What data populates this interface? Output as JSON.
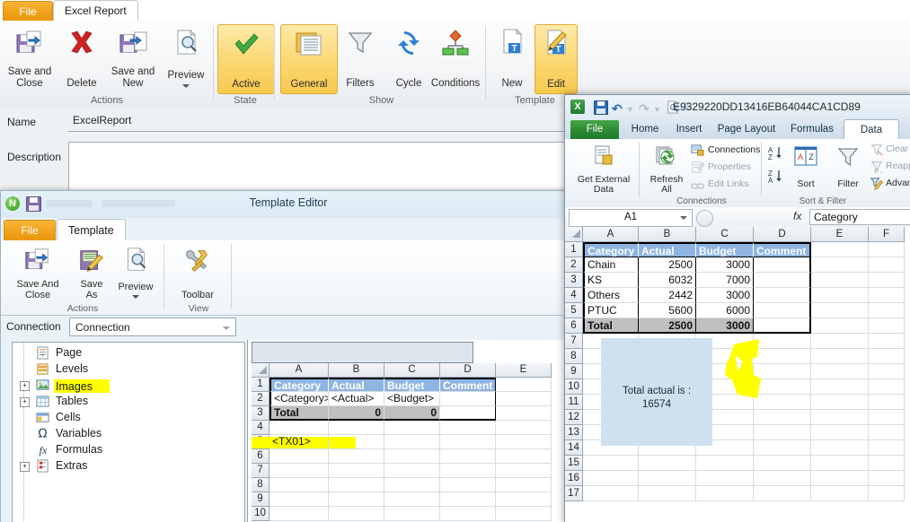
{
  "report_window": {
    "tabs": {
      "file": "File",
      "active": "Excel Report"
    },
    "ribbon_groups": [
      {
        "label": "Actions"
      },
      {
        "label": "State"
      },
      {
        "label": "Show"
      },
      {
        "label": "Template"
      }
    ],
    "buttons": {
      "save_and_close": "Save and\nClose",
      "save_and_close_l1": "Save and",
      "save_and_close_l2": "Close",
      "delete": "Delete",
      "save_and_new_l1": "Save and",
      "save_and_new_l2": "New",
      "preview": "Preview",
      "active": "Active",
      "general": "General",
      "filters": "Filters",
      "cycle": "Cycle",
      "conditions": "Conditions",
      "new": "New",
      "edit": "Edit"
    },
    "form": {
      "name_label": "Name",
      "name_value": "ExcelReport",
      "description_label": "Description",
      "description_value": ""
    }
  },
  "template_editor": {
    "title": "Template Editor",
    "tabs": {
      "file": "File",
      "active": "Template"
    },
    "ribbon_groups": [
      {
        "label": "Actions"
      },
      {
        "label": "View"
      }
    ],
    "buttons": {
      "save_and_close_l1": "Save And",
      "save_and_close_l2": "Close",
      "save_as_l1": "Save",
      "save_as_l2": "As",
      "preview": "Preview",
      "toolbar": "Toolbar"
    },
    "connection": {
      "label": "Connection",
      "value": "Connection"
    },
    "tree": [
      {
        "label": "Page",
        "icon": "page-icon",
        "expandable": false
      },
      {
        "label": "Levels",
        "icon": "levels-icon",
        "expandable": false
      },
      {
        "label": "Images",
        "icon": "images-icon",
        "expandable": true,
        "highlighted": true
      },
      {
        "label": "Tables",
        "icon": "tables-icon",
        "expandable": true
      },
      {
        "label": "Cells",
        "icon": "cells-icon",
        "expandable": false
      },
      {
        "label": "Variables",
        "icon": "omega-icon",
        "expandable": false
      },
      {
        "label": "Formulas",
        "icon": "fx-icon",
        "expandable": false
      },
      {
        "label": "Extras",
        "icon": "extras-icon",
        "expandable": true
      }
    ],
    "sheet": {
      "columns": [
        "A",
        "B",
        "C",
        "D",
        "E"
      ],
      "rows": [
        "1",
        "2",
        "3",
        "4",
        "5",
        "6",
        "7",
        "8",
        "9",
        "10"
      ],
      "data": [
        [
          "Category",
          "Actual",
          "Budget",
          "Comment",
          ""
        ],
        [
          "<Category>",
          "<Actual>",
          "<Budget>",
          "",
          ""
        ],
        [
          "Total",
          "0",
          "0",
          "",
          ""
        ],
        [
          "",
          "",
          "",
          "",
          ""
        ],
        [
          "<TX01>",
          "",
          "",
          "",
          ""
        ],
        [
          "",
          "",
          "",
          "",
          ""
        ],
        [
          "",
          "",
          "",
          "",
          ""
        ],
        [
          "",
          "",
          "",
          "",
          ""
        ],
        [
          "",
          "",
          "",
          "",
          ""
        ],
        [
          "",
          "",
          "",
          "",
          ""
        ]
      ],
      "highlighted_row": "5"
    }
  },
  "excel_window": {
    "title": "E9329220DD13416EB64044CA1CD89",
    "tabs": [
      {
        "label": "File"
      },
      {
        "label": "Home"
      },
      {
        "label": "Insert"
      },
      {
        "label": "Page Layout"
      },
      {
        "label": "Formulas"
      },
      {
        "label": "Data"
      }
    ],
    "ribbon_groups": [
      {
        "label": "Connections"
      },
      {
        "label": "Sort & Filter"
      }
    ],
    "buttons": {
      "get_external_data_l1": "Get External",
      "get_external_data_l2": "Data",
      "refresh_all_l1": "Refresh",
      "refresh_all_l2": "All",
      "connections": "Connections",
      "properties": "Properties",
      "edit_links": "Edit Links",
      "sort_az": "A↓",
      "sort_za": "Z↓",
      "sort": "Sort",
      "filter": "Filter",
      "clear": "Clear",
      "reapply": "Reapply",
      "advanced": "Advanced"
    },
    "formula_bar": {
      "name_box": "A1",
      "fx_label": "fx",
      "formula_value": "Category"
    },
    "sheet": {
      "columns": [
        "A",
        "B",
        "C",
        "D",
        "E",
        "F"
      ],
      "rows": [
        "1",
        "2",
        "3",
        "4",
        "5",
        "6",
        "7",
        "8",
        "9",
        "10",
        "11",
        "12",
        "13",
        "14",
        "15",
        "16",
        "17"
      ],
      "data": [
        [
          "Category",
          "Actual",
          "Budget",
          "Comment",
          "",
          ""
        ],
        [
          "Chain",
          "2500",
          "3000",
          "",
          "",
          ""
        ],
        [
          "KS",
          "6032",
          "7000",
          "",
          "",
          ""
        ],
        [
          "Others",
          "2442",
          "3000",
          "",
          "",
          ""
        ],
        [
          "PTUC",
          "5600",
          "6000",
          "",
          "",
          ""
        ],
        [
          "Total",
          "2500",
          "3000",
          "",
          "",
          ""
        ]
      ],
      "textbox": {
        "line1": "Total actual is :",
        "line2": "16574"
      }
    }
  },
  "colors": {
    "accent_orange": "#f0a21b",
    "excel_green": "#2d8a33",
    "header_blue": "#8eb4e3",
    "total_gray": "#bfbfbf",
    "highlighter_yellow": "#ffff00",
    "textbox_blue": "#cfe0f0"
  }
}
